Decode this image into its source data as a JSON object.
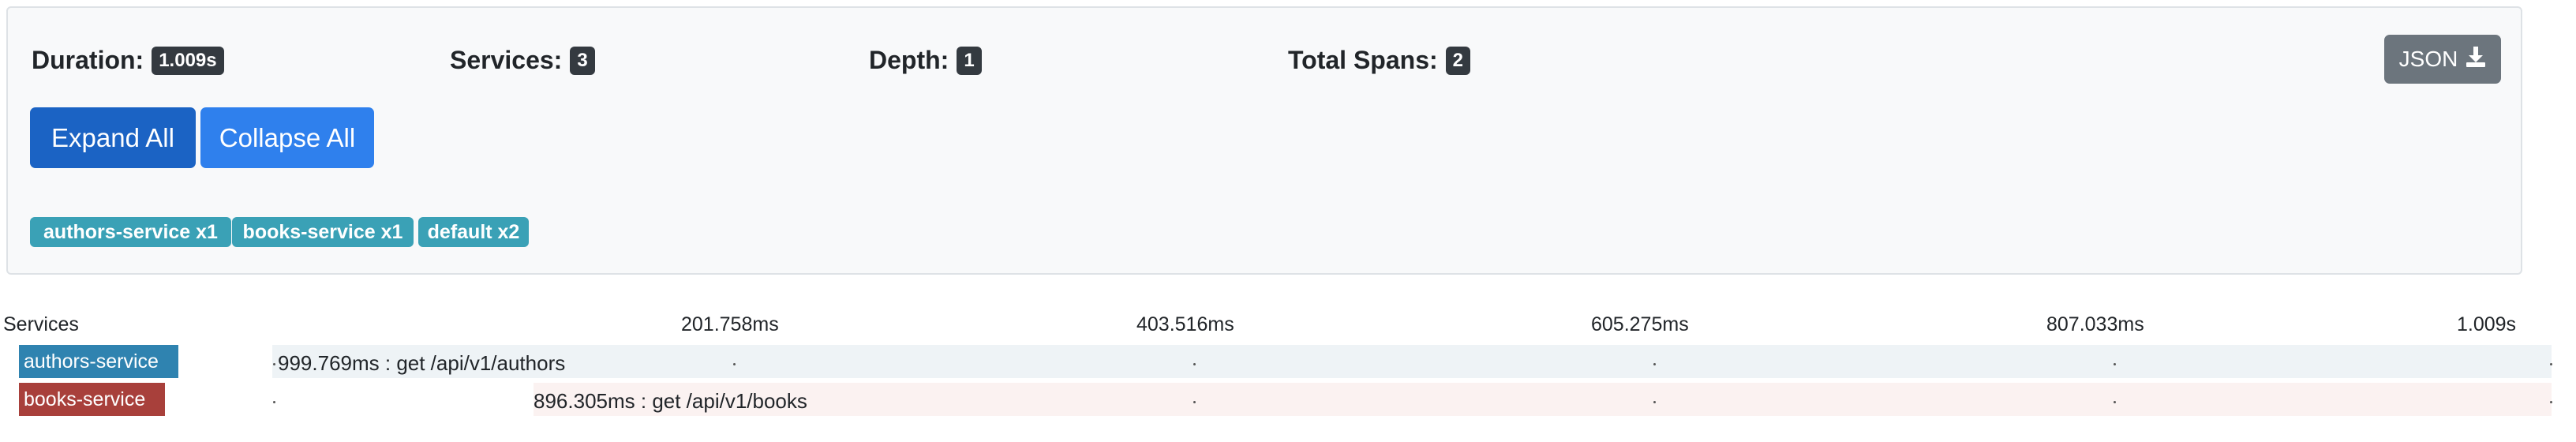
{
  "summary": {
    "duration_label": "Duration:",
    "duration_value": "1.009s",
    "services_label": "Services:",
    "services_value": "3",
    "depth_label": "Depth:",
    "depth_value": "1",
    "total_spans_label": "Total Spans:",
    "total_spans_value": "2",
    "json_label": "JSON",
    "json_icon": "download-icon"
  },
  "actions": {
    "expand_all": "Expand All",
    "collapse_all": "Collapse All"
  },
  "service_badges": [
    {
      "label": "authors-service x1"
    },
    {
      "label": "books-service x1"
    },
    {
      "label": "default x2"
    }
  ],
  "timeline": {
    "services_header": "Services",
    "ticks": [
      "201.758ms",
      "403.516ms",
      "605.275ms",
      "807.033ms",
      "1.009s"
    ],
    "rows": [
      {
        "service": "authors-service",
        "span": "999.769ms : get /api/v1/authors",
        "color": "#2f83b0"
      },
      {
        "service": "books-service",
        "span": "896.305ms : get /api/v1/books",
        "color": "#a8403b"
      }
    ]
  },
  "colors": {
    "badge_dark": "#343a40",
    "expand_button": "#1b63c4",
    "collapse_button": "#2f80ed",
    "service_badge": "#3aa1b6",
    "json_button": "#6c757d"
  }
}
